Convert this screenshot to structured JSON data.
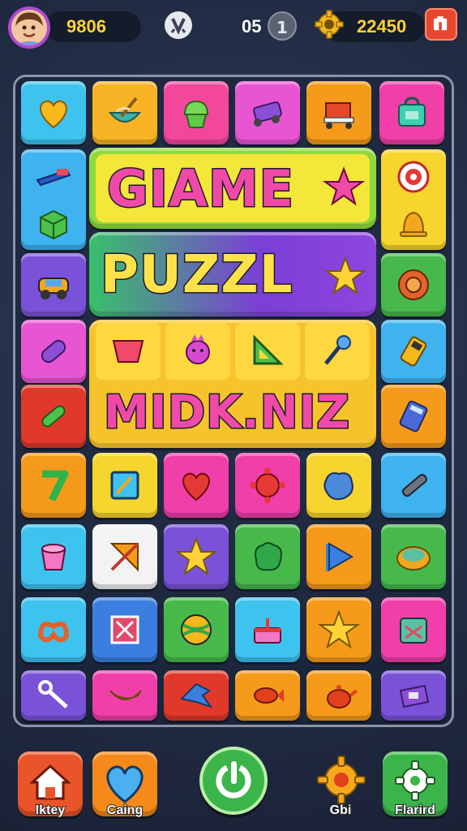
{
  "topbar": {
    "coins": "9806",
    "level_text": "05",
    "level_badge": "1",
    "gems": "22450"
  },
  "banners": {
    "game": "GIAME",
    "puzzle": "PUZZL",
    "middle": "MIDK.NIZ"
  },
  "board": {
    "tiles": [
      {
        "icon": "heart-icon",
        "color": "#3ec3ef"
      },
      {
        "icon": "bowl-whisk-icon",
        "color": "#f7b324"
      },
      {
        "icon": "cupcake-icon",
        "color": "#f2479a"
      },
      {
        "icon": "roller-skate-icon",
        "color": "#e855d3"
      },
      {
        "icon": "cart-icon",
        "color": "#f59a1a"
      },
      {
        "icon": "bag-icon",
        "color": "#f03fa9"
      },
      {
        "icon": "stapler-icon",
        "color": "#3fb3ef"
      },
      {
        "icon": "target-icon",
        "color": "#f6d52e"
      },
      {
        "icon": "cube-icon",
        "color": "#3fb3ef"
      },
      {
        "icon": "bell-icon",
        "color": "#f6d52e"
      },
      {
        "icon": "car-icon",
        "color": "#7a52d8"
      },
      {
        "icon": "ring-icon",
        "color": "#46b94a"
      },
      {
        "icon": "pill-icon",
        "color": "#e855d3"
      },
      {
        "icon": "bucket-icon",
        "color": "#f7c32c"
      },
      {
        "icon": "flower-icon",
        "color": "#f7c32c"
      },
      {
        "icon": "triangle-icon",
        "color": "#f7c32c"
      },
      {
        "icon": "key-icon",
        "color": "#f7c32c"
      },
      {
        "icon": "phone-icon",
        "color": "#3fb3ef"
      },
      {
        "icon": "leaf-icon",
        "color": "#e0392b"
      },
      {
        "icon": "calculator-icon",
        "color": "#f59a1a"
      },
      {
        "icon": "seven-icon",
        "color": "#f59a1a"
      },
      {
        "icon": "frame-icon",
        "color": "#f6d52e"
      },
      {
        "icon": "heart-icon",
        "color": "#f03fa9"
      },
      {
        "icon": "gear-blob-icon",
        "color": "#f03fa9"
      },
      {
        "icon": "puzzle-blob-icon",
        "color": "#f6d52e"
      },
      {
        "icon": "pen-icon",
        "color": "#3fb3ef"
      },
      {
        "icon": "cup-icon",
        "color": "#3ec3ef"
      },
      {
        "icon": "kite-icon",
        "color": "#f3f3f3"
      },
      {
        "icon": "star-icon",
        "color": "#7a52d8"
      },
      {
        "icon": "blob-icon",
        "color": "#46b94a"
      },
      {
        "icon": "flag-icon",
        "color": "#f59a1a"
      },
      {
        "icon": "plate-icon",
        "color": "#46b94a"
      },
      {
        "icon": "pretzel-icon",
        "color": "#3ec3ef"
      },
      {
        "icon": "x-box-icon",
        "color": "#3a7fe0"
      },
      {
        "icon": "ball-icon",
        "color": "#46b94a"
      },
      {
        "icon": "cake-icon",
        "color": "#3ec3ef"
      },
      {
        "icon": "star-icon",
        "color": "#f59a1a"
      },
      {
        "icon": "box-icon",
        "color": "#f03fa9"
      },
      {
        "icon": "wrench-icon",
        "color": "#7a52d8"
      },
      {
        "icon": "banana-icon",
        "color": "#f03fa9"
      },
      {
        "icon": "bird-icon",
        "color": "#e0392b"
      },
      {
        "icon": "fish-icon",
        "color": "#f59a1a"
      },
      {
        "icon": "teapot-icon",
        "color": "#f59a1a"
      },
      {
        "icon": "purse-icon",
        "color": "#7a52d8"
      }
    ]
  },
  "nav": {
    "home_label": "Iktey",
    "gaming_label": "Caing",
    "settings_label": "Gbi",
    "profile_label": "Flarird"
  }
}
